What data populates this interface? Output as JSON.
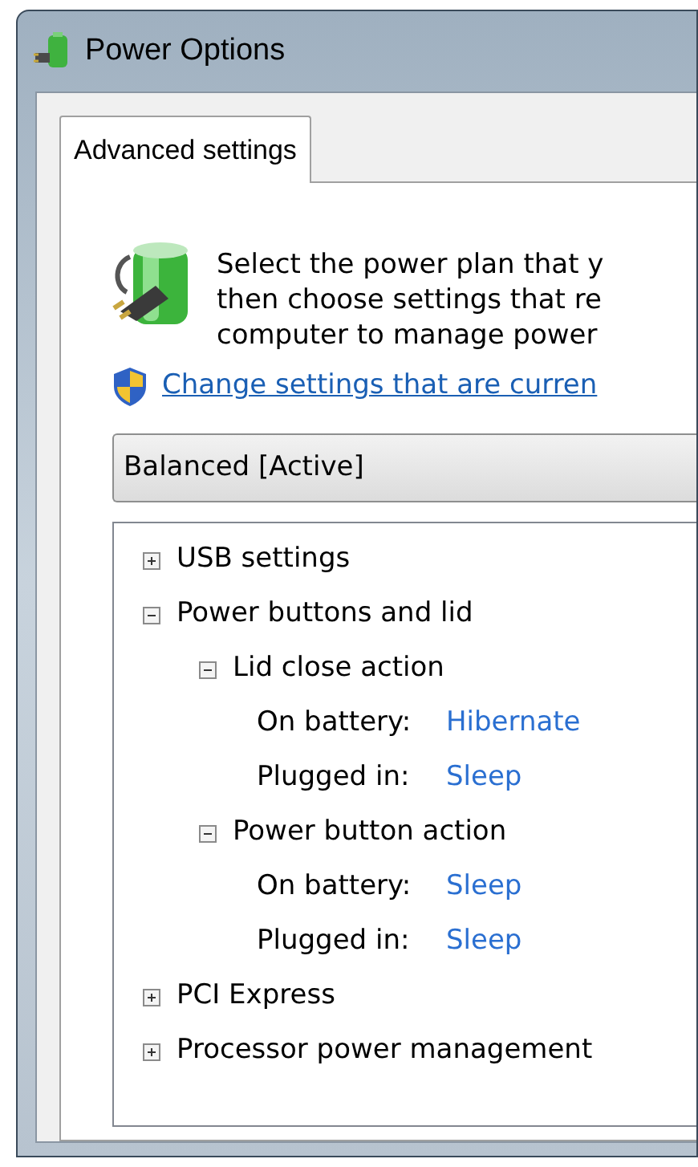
{
  "window": {
    "title": "Power Options"
  },
  "tabs": [
    {
      "label": "Advanced settings",
      "selected": true
    }
  ],
  "description": [
    "Select the power plan that y",
    "then choose settings that re",
    "computer to manage power"
  ],
  "link": "Change settings that are curren",
  "plan_dropdown": {
    "value": "Balanced [Active]"
  },
  "tree": {
    "items": [
      {
        "kind": "group",
        "label": "USB settings",
        "expanded": false
      },
      {
        "kind": "group",
        "label": "Power buttons and lid",
        "expanded": true,
        "children": [
          {
            "kind": "group",
            "label": "Lid close action",
            "expanded": true,
            "children": [
              {
                "kind": "setting",
                "label": "On battery:",
                "value": "Hibernate"
              },
              {
                "kind": "setting",
                "label": "Plugged in:",
                "value": "Sleep"
              }
            ]
          },
          {
            "kind": "group",
            "label": "Power button action",
            "expanded": true,
            "children": [
              {
                "kind": "setting",
                "label": "On battery:",
                "value": "Sleep"
              },
              {
                "kind": "setting",
                "label": "Plugged in:",
                "value": "Sleep"
              }
            ]
          }
        ]
      },
      {
        "kind": "group",
        "label": "PCI Express",
        "expanded": false
      },
      {
        "kind": "group",
        "label": "Processor power management",
        "expanded": false
      }
    ]
  }
}
